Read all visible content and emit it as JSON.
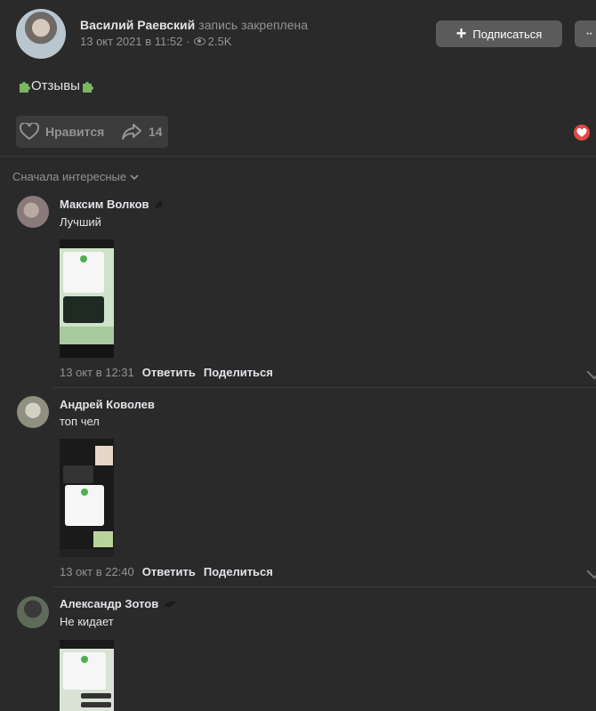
{
  "post": {
    "author_name": "Василий Раевский",
    "pinned_label": "запись закреплена",
    "date": "13 окт 2021 в 11:52",
    "views": "2.5K",
    "subscribe_label": "Подписаться",
    "more_label": "··",
    "text": "Отзывы",
    "like_label": "Нравится",
    "share_count": "14",
    "icons": [
      "avatar",
      "eye-icon",
      "plus-icon",
      "more-icon",
      "puzzle-icon",
      "heart-icon",
      "share-icon",
      "heart-reaction-icon"
    ],
    "colors": {
      "background": "#2a2a2b",
      "button": "#5b5b5c",
      "accent_red": "#e64646",
      "muted": "#939393"
    }
  },
  "comments_sort_label": "Сначала интересные",
  "comments": [
    {
      "name": "Максим Волков",
      "text": "Лучший",
      "date": "13 окт в 12:31",
      "reply_label": "Ответить",
      "share_label": "Поделиться"
    },
    {
      "name": "Андрей Коволев",
      "text": "топ чел",
      "date": "13 окт в 22:40",
      "reply_label": "Ответить",
      "share_label": "Поделиться"
    },
    {
      "name": "Александр Зотов",
      "text": "Не кидает"
    }
  ]
}
